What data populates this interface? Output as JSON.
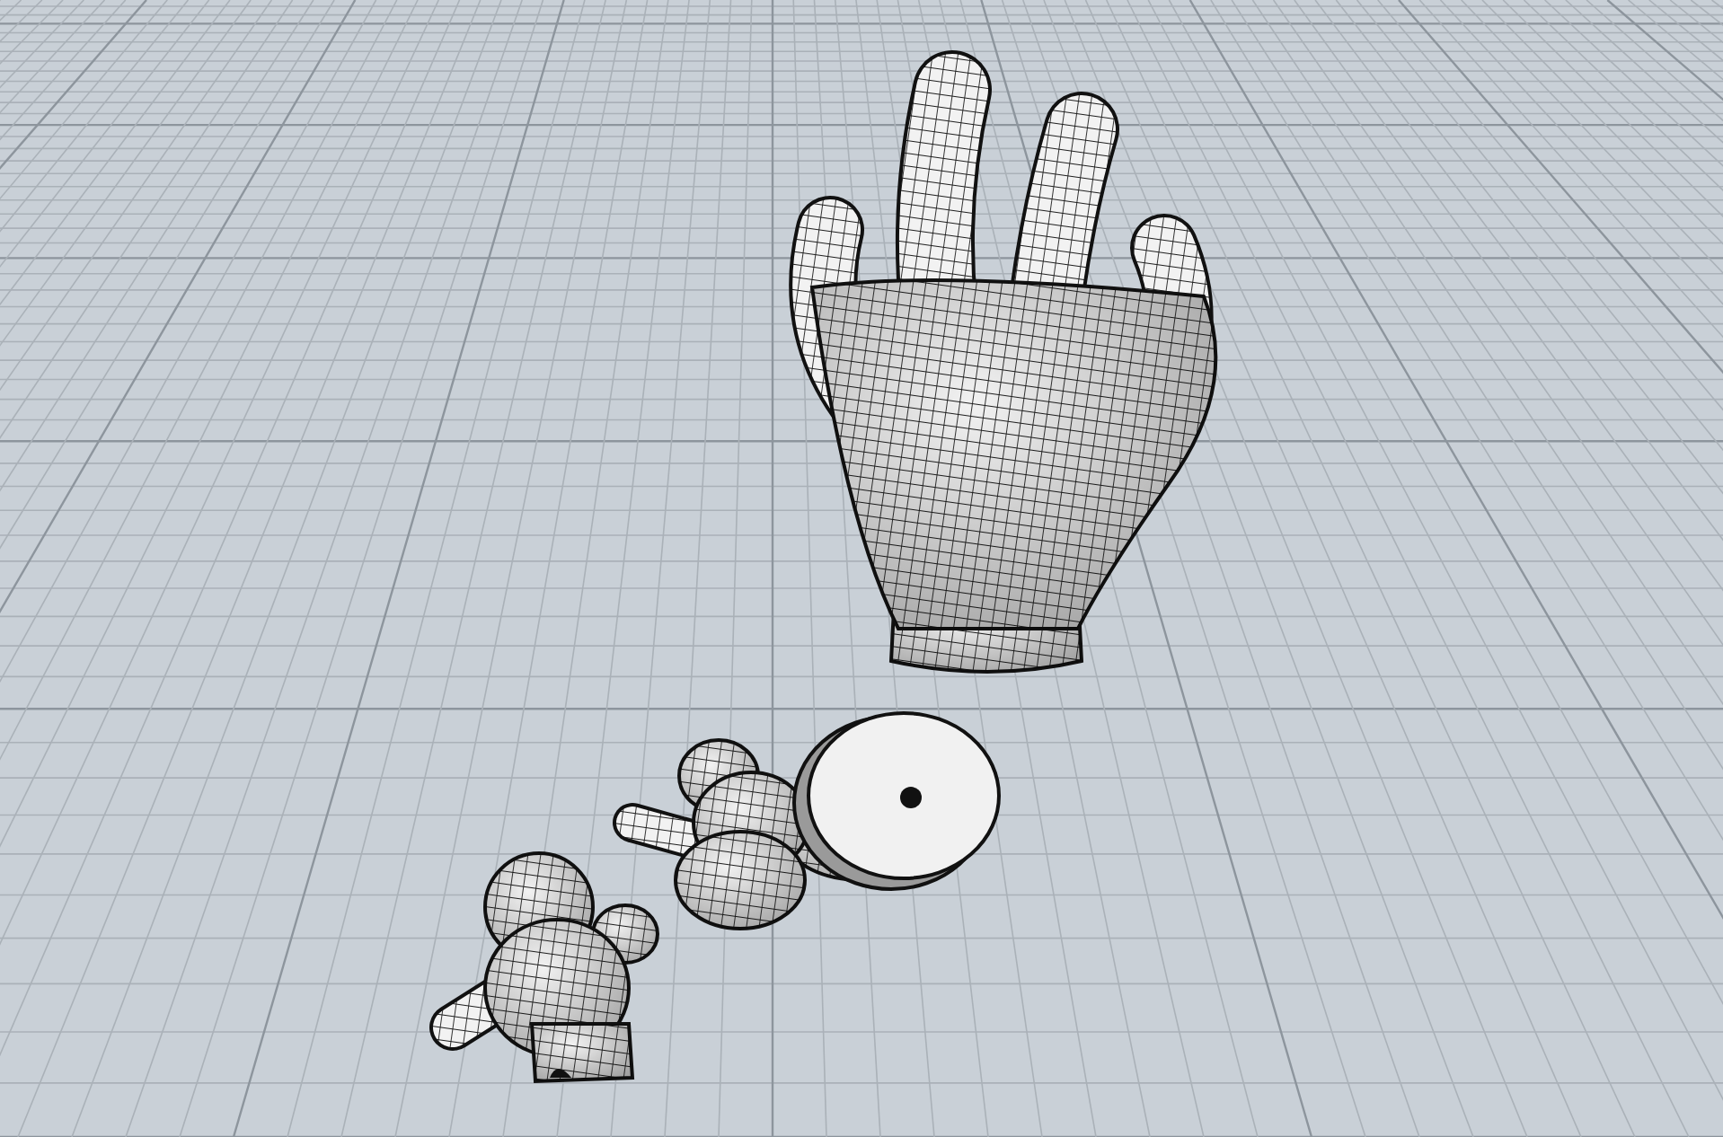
{
  "viewport": {
    "objects": [
      {
        "kind": "hand"
      },
      {
        "kind": "torso"
      },
      {
        "kind": "disc"
      },
      {
        "kind": "figure"
      }
    ]
  }
}
